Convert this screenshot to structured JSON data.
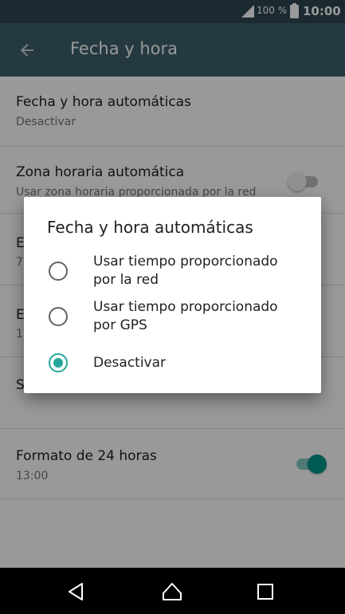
{
  "status": {
    "battery": "100 %",
    "time": "10:00"
  },
  "toolbar": {
    "title": "Fecha y hora"
  },
  "list": {
    "rows": [
      {
        "title": "Fecha y hora automáticas",
        "subtitle": "Desactivar"
      },
      {
        "title": "Zona horaria automática",
        "subtitle": "Usar zona horaria proporcionada por la red",
        "switch_on": false
      },
      {
        "title": "E",
        "subtitle": "7"
      },
      {
        "title": "E",
        "subtitle": "1"
      },
      {
        "title": "S",
        "subtitle": ""
      },
      {
        "title": "Formato de 24 horas",
        "subtitle": "13:00",
        "switch_on": true
      }
    ]
  },
  "dialog": {
    "title": "Fecha y hora automáticas",
    "options": [
      {
        "label": "Usar tiempo proporcionado por la red",
        "selected": false
      },
      {
        "label": "Usar tiempo proporcionado por GPS",
        "selected": false
      },
      {
        "label": "Desactivar",
        "selected": true
      }
    ]
  },
  "colors": {
    "accent": "#26a69a",
    "toolbar": "#3e5f6d",
    "statusbar": "#2d4550"
  },
  "icons": {
    "back": "arrow-left-icon",
    "nav_back": "triangle-back-icon",
    "nav_home": "home-icon",
    "nav_recent": "square-recent-icon"
  }
}
